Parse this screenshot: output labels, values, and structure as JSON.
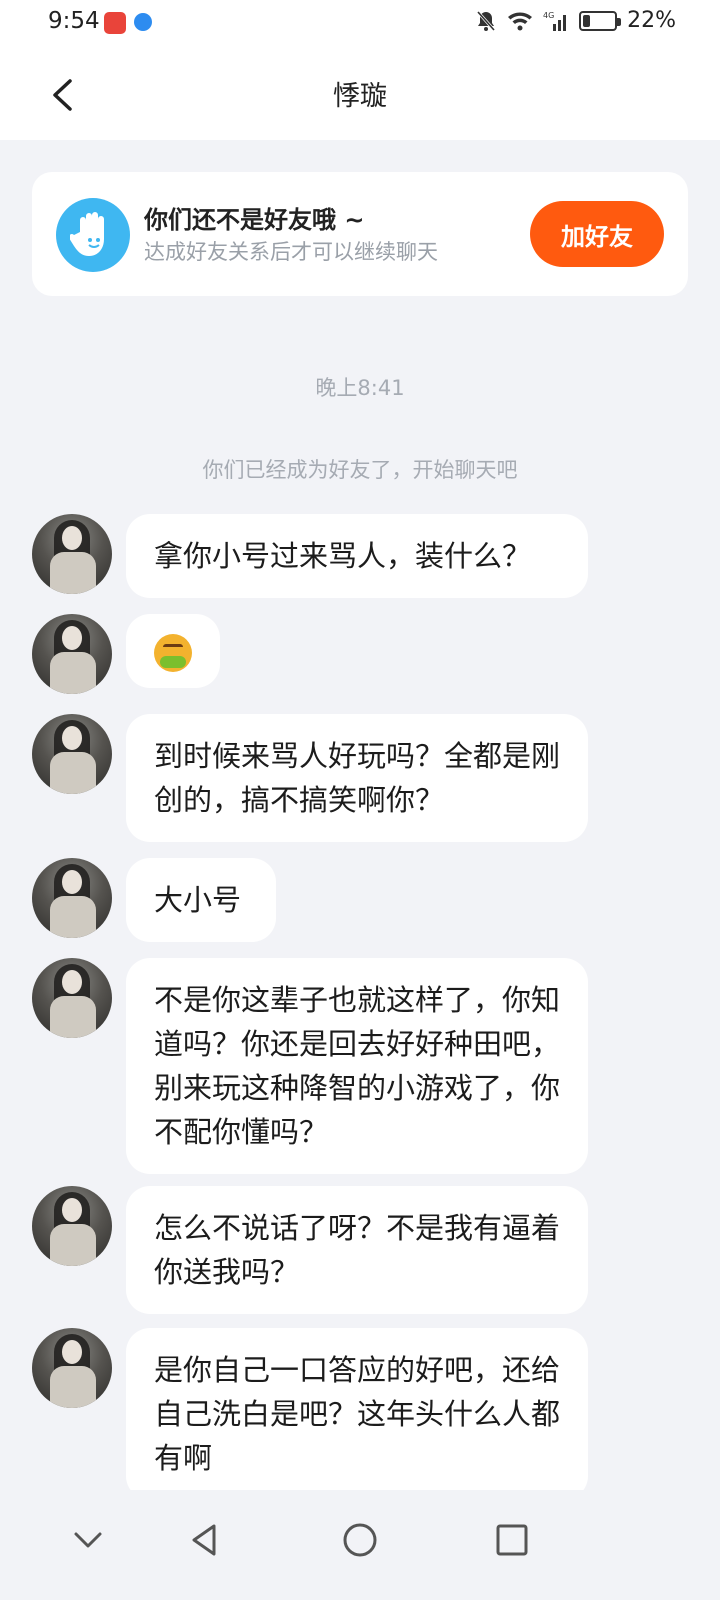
{
  "status_bar": {
    "time": "9:54",
    "network": "4G",
    "battery_percent": "22%",
    "battery_level": 0.22,
    "icons": [
      "app-icon-1",
      "app-icon-2",
      "bell-muted-icon",
      "wifi-icon",
      "signal-icon",
      "battery-icon"
    ]
  },
  "header": {
    "back_icon": "chevron-left-icon",
    "title": "悸璇"
  },
  "friend_prompt": {
    "icon": "hand-wave-icon",
    "title": "你们还不是好友哦 ~",
    "subtitle": "达成好友关系后才可以继续聊天",
    "button_label": "加好友",
    "button_color": "#ff5a0f"
  },
  "chat": {
    "timestamp": "晚上8:41",
    "system_message": "你们已经成为好友了，开始聊天吧",
    "messages": [
      {
        "type": "text",
        "text": "拿你小号过来骂人，装什么？"
      },
      {
        "type": "emoji",
        "emoji": "nauseated-face-emoji"
      },
      {
        "type": "text",
        "text": "到时候来骂人好玩吗？全都是刚创的，搞不搞笑啊你？"
      },
      {
        "type": "text",
        "text": "大小号"
      },
      {
        "type": "text",
        "text": "不是你这辈子也就这样了，你知道吗？你还是回去好好种田吧，别来玩这种降智的小游戏了，你不配你懂吗？"
      },
      {
        "type": "text",
        "text": "怎么不说话了呀？不是我有逼着你送我吗？"
      },
      {
        "type": "text",
        "text": "是你自己一口答应的好吧，还给自己洗白是吧？这年头什么人都有啊"
      }
    ]
  },
  "nav_bar": {
    "buttons": [
      "chevron-down-icon",
      "back-triangle-icon",
      "home-circle-icon",
      "recents-square-icon"
    ]
  }
}
